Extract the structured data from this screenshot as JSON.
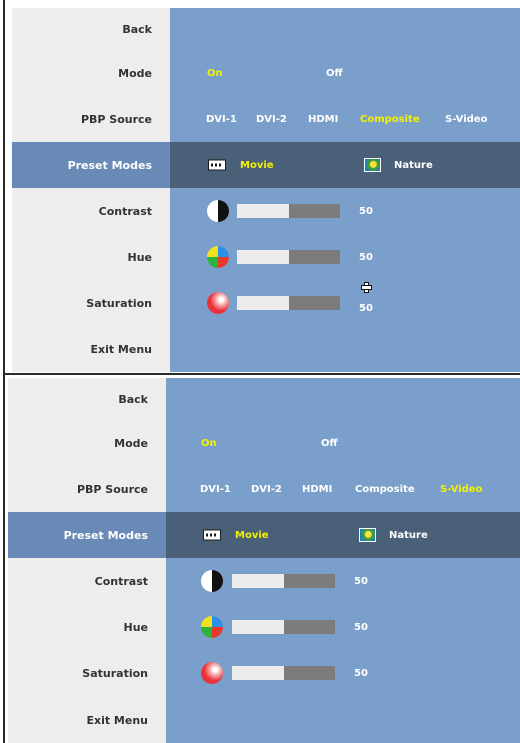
{
  "screens": [
    {
      "menu": {
        "back": "Back",
        "mode": {
          "label": "Mode",
          "options": [
            "On",
            "Off"
          ],
          "selected": "On"
        },
        "pbp_source": {
          "label": "PBP Source",
          "options": [
            "DVI-1",
            "DVI-2",
            "HDMI",
            "Composite",
            "S-Video"
          ],
          "selected": "Composite"
        },
        "preset_modes": {
          "label": "Preset Modes",
          "options": [
            {
              "label": "Movie",
              "icon": "movie-icon"
            },
            {
              "label": "Nature",
              "icon": "nature-icon"
            }
          ],
          "selected": "Movie"
        },
        "contrast": {
          "label": "Contrast",
          "value": "50",
          "level": 0.5,
          "icon": "contrast-icon"
        },
        "hue": {
          "label": "Hue",
          "value": "50",
          "level": 0.5,
          "icon": "hue-icon"
        },
        "saturation": {
          "label": "Saturation",
          "value": "50",
          "level": 0.5,
          "icon": "saturation-icon"
        },
        "exit": "Exit Menu"
      },
      "cursor_icon": "crosshair-cursor-icon"
    },
    {
      "menu": {
        "back": "Back",
        "mode": {
          "label": "Mode",
          "options": [
            "On",
            "Off"
          ],
          "selected": "On"
        },
        "pbp_source": {
          "label": "PBP Source",
          "options": [
            "DVI-1",
            "DVI-2",
            "HDMI",
            "Composite",
            "S-Video"
          ],
          "selected": "S-Video"
        },
        "preset_modes": {
          "label": "Preset Modes",
          "options": [
            {
              "label": "Movie",
              "icon": "movie-icon"
            },
            {
              "label": "Nature",
              "icon": "nature-icon"
            }
          ],
          "selected": "Movie"
        },
        "contrast": {
          "label": "Contrast",
          "value": "50",
          "level": 0.5,
          "icon": "contrast-icon"
        },
        "hue": {
          "label": "Hue",
          "value": "50",
          "level": 0.5,
          "icon": "hue-icon"
        },
        "saturation": {
          "label": "Saturation",
          "value": "50",
          "level": 0.5,
          "icon": "saturation-icon"
        },
        "exit": "Exit Menu"
      }
    }
  ],
  "colors": {
    "panel_background": "#7b9fcb",
    "label_column": "#ededeb",
    "selected_row": "#4a6079",
    "selected_label": "#6989b7",
    "active_option": "#f2f201",
    "slider_fill": "#ececec",
    "slider_track": "#7c7c7c"
  }
}
